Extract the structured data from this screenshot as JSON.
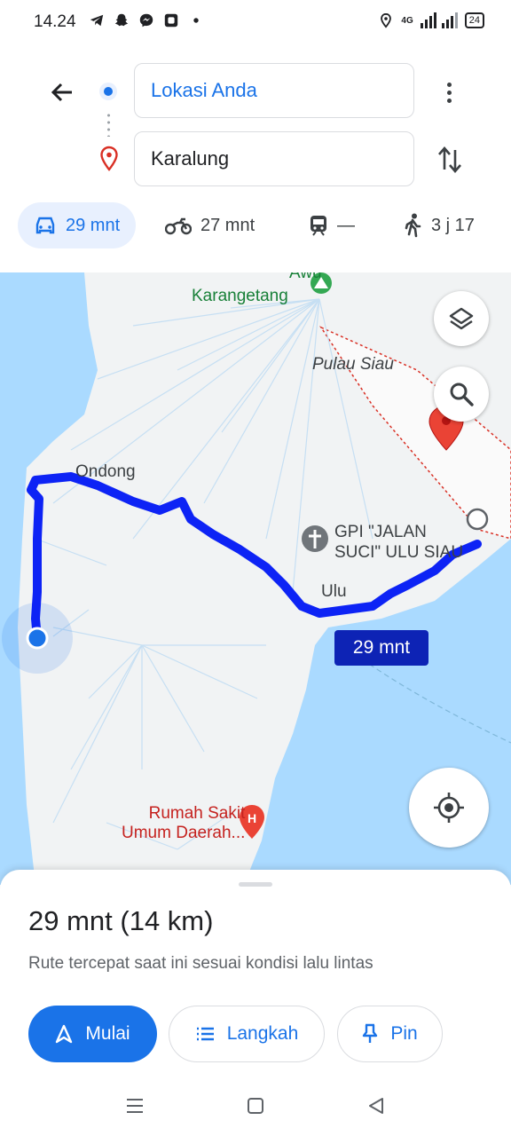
{
  "status_bar": {
    "time": "14.24",
    "network": "4G",
    "battery": "24",
    "icons": [
      "telegram-icon",
      "snapchat-icon",
      "messenger-icon",
      "app-icon",
      "dot-icon",
      "location-icon",
      "signal-icon",
      "battery-icon"
    ]
  },
  "header": {
    "origin": "Lokasi Anda",
    "destination": "Karalung"
  },
  "modes": [
    {
      "name": "car",
      "label": "29 mnt",
      "active": true
    },
    {
      "name": "motorcycle",
      "label": "27 mnt",
      "active": false
    },
    {
      "name": "transit",
      "label": "—",
      "active": false
    },
    {
      "name": "walk",
      "label": "3 j 17",
      "active": false
    }
  ],
  "map": {
    "labels": {
      "awu": "Awu",
      "karangetang": "Karangetang",
      "pulau_siau": "Pulau Siau",
      "ondong": "Ondong",
      "gpi_line1": "GPI \"JALAN",
      "gpi_line2": "SUCI\" ULU SIAU",
      "ulu": "Ulu",
      "rumah_sakit_line1": "Rumah Sakit",
      "rumah_sakit_line2": "Umum Daerah..."
    },
    "route_time": "29 mnt",
    "colors": {
      "water": "#aadaff",
      "land": "#f1f3f4",
      "route": "#0d23f5",
      "route_label": "#0d23b5"
    }
  },
  "sheet": {
    "summary": "29 mnt (14 km)",
    "note": "Rute tercepat saat ini sesuai kondisi lalu lintas",
    "buttons": {
      "start": "Mulai",
      "steps": "Langkah",
      "pin": "Pin"
    }
  }
}
